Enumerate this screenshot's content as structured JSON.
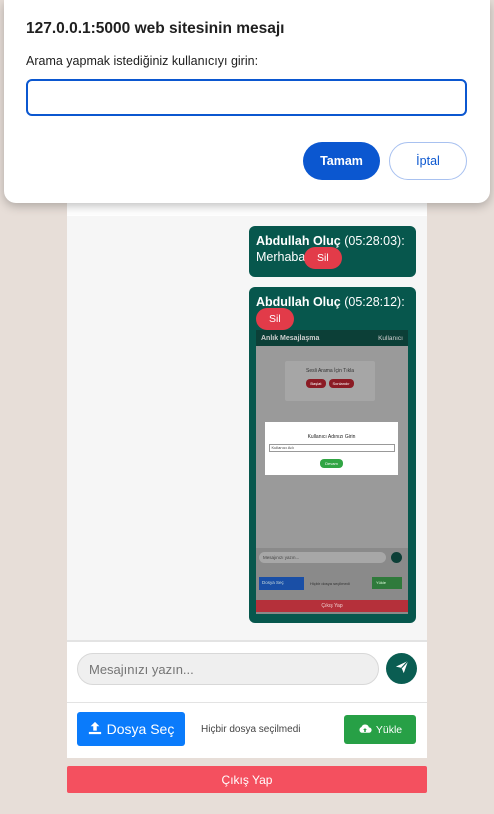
{
  "dialog": {
    "title": "127.0.0.1:5000 web sitesinin mesajı",
    "message": "Arama yapmak istediğiniz kullanıcıyı girin:",
    "input_value": "",
    "ok_label": "Tamam",
    "cancel_label": "İptal"
  },
  "messages": [
    {
      "sender": "Abdullah Oluç",
      "time": "(05:28:03):",
      "text": "Merhaba",
      "delete_label": "Sil"
    },
    {
      "sender": "Abdullah Oluç",
      "time": "(05:28:12):",
      "text": "",
      "delete_label": "Sil"
    }
  ],
  "thumbnail": {
    "header_title": "Anlık Mesajlaşma",
    "header_right": "Kullanıcı",
    "card_title": "Sesli Arama İçin Tıkla",
    "card_btn1": "Başlat",
    "card_btn2": "Sonlandır",
    "modal_title": "Kullanıcı Adınızı Girin",
    "modal_input": "Kullanıcı Adı",
    "modal_button": "Devam",
    "input_placeholder": "Mesajınızı yazın...",
    "file_button": "Dosya Seç",
    "file_none": "Hiçbir dosya seçilmedi",
    "upload_button": "Yükle",
    "exit_button": "Çıkış Yap"
  },
  "compose": {
    "placeholder": "Mesajınızı yazın..."
  },
  "files": {
    "choose_label": "Dosya Seç",
    "none_label": "Hiçbir dosya seçilmedi",
    "upload_label": "Yükle"
  },
  "logout_label": "Çıkış Yap",
  "colors": {
    "message_bg": "#07574d",
    "delete_red": "#e23b49",
    "send_green": "#0a5d52",
    "file_blue": "#0a7bfb",
    "upload_green": "#27a046",
    "logout_red": "#f4505f",
    "dialog_blue": "#0b57d0"
  }
}
